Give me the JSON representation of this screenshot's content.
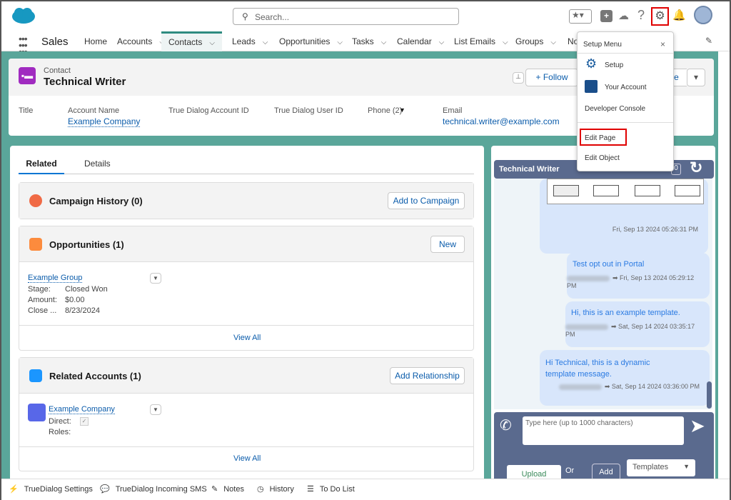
{
  "header": {
    "search_placeholder": "Search...",
    "icons": [
      "favorites-star-icon",
      "add-icon",
      "trailhead-icon",
      "help-icon",
      "setup-gear-icon",
      "notifications-bell-icon",
      "avatar"
    ]
  },
  "nav": {
    "app_name": "Sales",
    "items": [
      {
        "label": "Home"
      },
      {
        "label": "Accounts"
      },
      {
        "label": "Contacts",
        "active": true
      },
      {
        "label": "Leads"
      },
      {
        "label": "Opportunities"
      },
      {
        "label": "Tasks"
      },
      {
        "label": "Calendar"
      },
      {
        "label": "List Emails"
      },
      {
        "label": "Groups"
      },
      {
        "label": "No"
      }
    ]
  },
  "record": {
    "object": "Contact",
    "name": "Technical Writer",
    "follow_label": "Follow",
    "partial_button": "e",
    "fields": [
      {
        "label": "Title",
        "value": ""
      },
      {
        "label": "Account Name",
        "value": "Example Company"
      },
      {
        "label": "True Dialog Account ID",
        "value": ""
      },
      {
        "label": "True Dialog User ID",
        "value": ""
      },
      {
        "label": "Phone (2)",
        "value": ""
      },
      {
        "label": "Email",
        "value": "technical.writer@example.com"
      }
    ]
  },
  "tabs": [
    {
      "label": "Related",
      "active": true
    },
    {
      "label": "Details"
    }
  ],
  "related": {
    "campaign": {
      "title": "Campaign History (0)",
      "button": "Add to Campaign"
    },
    "opportunities": {
      "title": "Opportunities (1)",
      "button": "New",
      "item": {
        "name": "Example Group",
        "rows": [
          {
            "k": "Stage:",
            "v": "Closed Won"
          },
          {
            "k": "Amount:",
            "v": "$0.00"
          },
          {
            "k": "Close ...",
            "v": "8/23/2024"
          }
        ]
      },
      "view_all": "View All"
    },
    "accounts": {
      "title": "Related Accounts (1)",
      "button": "Add Relationship",
      "item": {
        "name": "Example Company",
        "direct": "Direct:",
        "roles": "Roles:",
        "direct_checked": true
      },
      "view_all": "View All"
    }
  },
  "setup_menu": {
    "title": "Setup Menu",
    "items": [
      "Setup",
      "Your Account",
      "Developer Console",
      "Edit Page",
      "Edit Object"
    ],
    "highlighted": "Edit Page"
  },
  "chat": {
    "title": "Technical Writer",
    "count": "0",
    "messages": [
      {
        "text": "",
        "ts": "Fri, Sep 13 2024 05:26:31 PM"
      },
      {
        "text": "Test opt out in Portal",
        "ts": "Fri, Sep 13 2024 05:29:12 PM"
      },
      {
        "text": "Hi, this is an example template.",
        "ts": "Sat, Sep 14 2024 03:35:17 PM"
      },
      {
        "text": "Hi Technical, this is a dynamic template message.",
        "ts": "Sat, Sep 14 2024 03:36:00 PM"
      }
    ],
    "input_placeholder": "Type here (up to 1000 characters)",
    "upload": "Upload",
    "or": "Or",
    "add": "Add",
    "templates": "Templates"
  },
  "utility_bar": [
    "TrueDialog Settings",
    "TrueDialog Incoming SMS",
    "Notes",
    "History",
    "To Do List"
  ],
  "colors": {
    "brand": "#0176d3",
    "teal": "#5aa69a",
    "chat_header": "#5a6a8e",
    "highlight": "#e00000"
  }
}
